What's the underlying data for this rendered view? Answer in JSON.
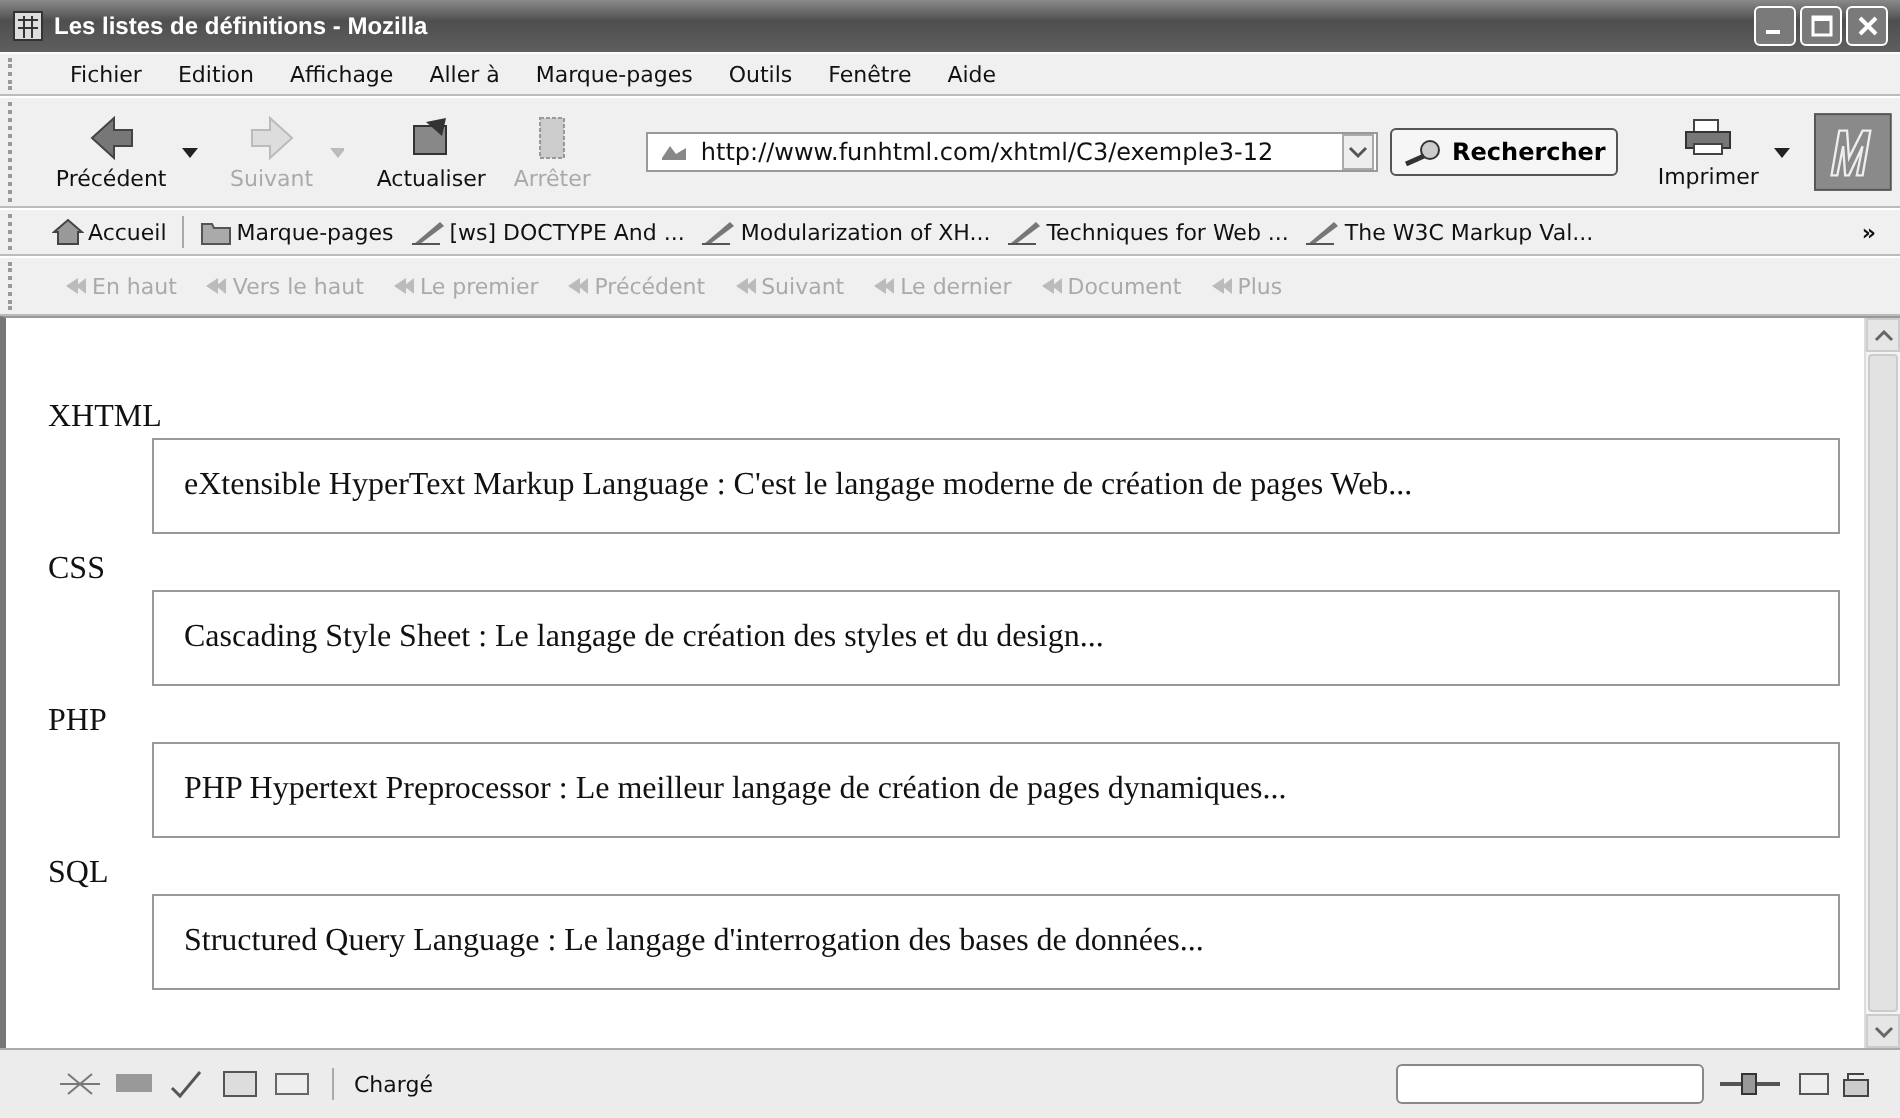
{
  "window": {
    "title": "Les listes de définitions - Mozilla"
  },
  "menu": [
    "Fichier",
    "Edition",
    "Affichage",
    "Aller à",
    "Marque-pages",
    "Outils",
    "Fenêtre",
    "Aide"
  ],
  "nav_buttons": [
    {
      "kind": "back",
      "label": "Précédent",
      "disabled": false,
      "dropdown": true
    },
    {
      "kind": "forward",
      "label": "Suivant",
      "disabled": true,
      "dropdown": true
    },
    {
      "kind": "reload",
      "label": "Actualiser",
      "disabled": false,
      "dropdown": false
    },
    {
      "kind": "stop",
      "label": "Arrêter",
      "disabled": true,
      "dropdown": false
    }
  ],
  "address": {
    "value": "http://www.funhtml.com/xhtml/C3/exemple3-12"
  },
  "search_button": "Rechercher",
  "print_button": {
    "label": "Imprimer"
  },
  "bookmarks": [
    {
      "kind": "home",
      "label": "Accueil"
    },
    {
      "kind": "folder",
      "label": "Marque-pages"
    },
    {
      "kind": "link",
      "label": "[ws] DOCTYPE And ..."
    },
    {
      "kind": "link",
      "label": "Modularization of XH..."
    },
    {
      "kind": "link",
      "label": "Techniques for Web ..."
    },
    {
      "kind": "link",
      "label": "The W3C Markup Val..."
    }
  ],
  "bookmarks_more": "»",
  "site_nav": [
    {
      "label": "En haut",
      "disabled": true
    },
    {
      "label": "Vers le haut",
      "disabled": true
    },
    {
      "label": "Le premier",
      "disabled": true
    },
    {
      "label": "Précédent",
      "disabled": true
    },
    {
      "label": "Suivant",
      "disabled": true
    },
    {
      "label": "Le dernier",
      "disabled": true
    },
    {
      "label": "Document",
      "disabled": true
    },
    {
      "label": "Plus",
      "disabled": true
    }
  ],
  "definitions": [
    {
      "term": "XHTML",
      "description": "eXtensible HyperText Markup Language : C'est le langage moderne de création de pages Web..."
    },
    {
      "term": "CSS",
      "description": "Cascading Style Sheet : Le langage de création des styles et du design..."
    },
    {
      "term": "PHP",
      "description": "PHP Hypertext Preprocessor : Le meilleur langage de création de pages dynamiques..."
    },
    {
      "term": "SQL",
      "description": "Structured Query Language : Le langage d'interrogation des bases de données..."
    }
  ],
  "status_bar": {
    "text": "Chargé"
  }
}
